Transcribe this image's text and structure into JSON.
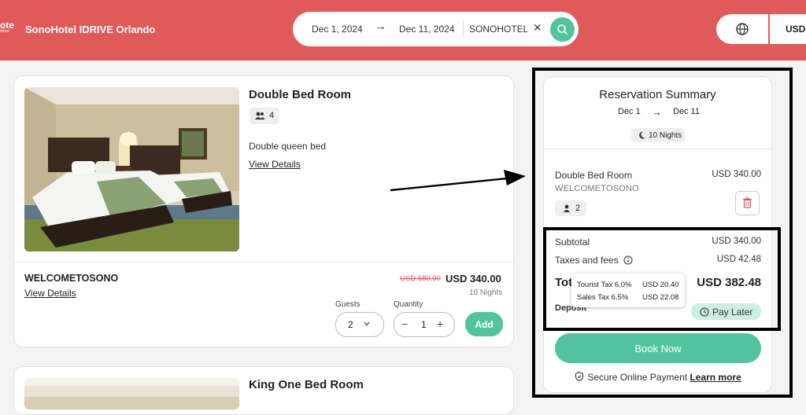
{
  "header": {
    "logo_text": "ote",
    "logo_sub": "ldrive",
    "hotel_name": "SonoHotel IDRIVE Orlando",
    "search": {
      "checkin": "Dec 1, 2024",
      "checkout": "Dec 11, 2024",
      "promo_code": "SONOHOTELII"
    },
    "language_icon": "globe-icon",
    "currency": "USD"
  },
  "rooms": [
    {
      "title": "Double Bed Room",
      "capacity": "4",
      "bed": "Double queen bed",
      "details_label": "View Details",
      "rate": {
        "name": "WELCOMETOSONO",
        "details_label": "View Details",
        "old_price": "USD 680.00",
        "price": "USD 340.00",
        "nights": "10 Nights"
      },
      "guests_label": "Guests",
      "guests_value": "2",
      "quantity_label": "Quantity",
      "quantity_value": "1",
      "add_label": "Add"
    },
    {
      "title": "King One Bed Room"
    }
  ],
  "summary": {
    "title": "Reservation Summary",
    "date_from": "Dec 1",
    "date_to": "Dec 11",
    "nights": "10 Nights",
    "item": {
      "room": "Double Bed Room",
      "price": "USD 340.00",
      "promo": "WELCOMETOSONO",
      "guests": "2"
    },
    "subtotal_label": "Subtotal",
    "subtotal": "USD 340.00",
    "taxes_label": "Taxes and fees",
    "taxes": "USD 42.48",
    "total_label": "Total",
    "total": "USD 382.48",
    "deposit_label": "Deposit",
    "pay_later": "Pay Later",
    "tax_tooltip": [
      {
        "name": "Tourist Tax 6.0%",
        "value": "USD 20.40"
      },
      {
        "name": "Sales Tax 6.5%",
        "value": "USD 22.08"
      }
    ],
    "book_now": "Book Now",
    "secure_text": "Secure Online Payment",
    "learn_more": "Learn more"
  },
  "colors": {
    "brand_header": "#e05a5c",
    "accent_green": "#53c39f",
    "strike_red": "#e0585a"
  }
}
